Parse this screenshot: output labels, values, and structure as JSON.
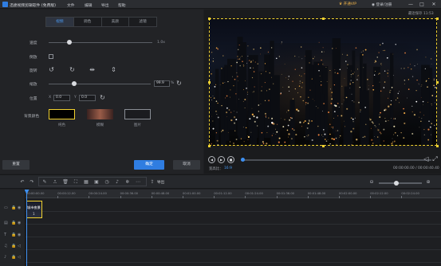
{
  "window": {
    "title": "迅捷视频剪辑软件 (免费版)",
    "menu": [
      "文件",
      "编辑",
      "导出",
      "帮助"
    ],
    "vip": "开通VIP",
    "login": "登录/注册",
    "controls": [
      "—",
      "□",
      "✕"
    ]
  },
  "edit_panel": {
    "tabs": [
      {
        "label": "视频",
        "active": true
      },
      {
        "label": "调色",
        "active": false
      },
      {
        "label": "美颜",
        "active": false
      },
      {
        "label": "滤镜",
        "active": false
      }
    ],
    "speed": {
      "label": "速度",
      "value": "1.0x",
      "level": 0.2
    },
    "reverse": {
      "label": "倒放",
      "checked": false
    },
    "rotate": {
      "label": "旋转",
      "icons": [
        "rotate-left-icon",
        "rotate-right-icon",
        "flip-horizontal-icon",
        "flip-vertical-icon"
      ]
    },
    "scale": {
      "label": "缩放",
      "value": "99.9",
      "unit": "%",
      "level": 0.25
    },
    "position": {
      "label": "位置",
      "x_label": "X",
      "x_value": "0.0",
      "y_label": "Y",
      "y_value": "0.0"
    },
    "background": {
      "label": "背景颜色",
      "options": [
        {
          "label": "纯色",
          "selected": true,
          "color": "#000000"
        },
        {
          "label": "模糊",
          "selected": false,
          "color": "#7a4a3a"
        },
        {
          "label": "图片",
          "selected": false,
          "color": "#1b1c1f"
        }
      ]
    },
    "buttons": {
      "reset": "重置",
      "ok": "确定",
      "cancel": "取消"
    }
  },
  "preview": {
    "autosave": "最近保存 11:53",
    "ratio_label": "宽高比：",
    "ratio_value": "16:9",
    "timecode": "00:00:00.00 / 00:00:40.40",
    "progress": 0.01
  },
  "timeline": {
    "export": "导出",
    "ruler": [
      "00:00:00.00",
      "00:00:12.00",
      "00:00:24.00",
      "00:00:36.00",
      "00:00:48.00",
      "00:01:00.00",
      "00:01:12.00",
      "00:01:24.00",
      "00:01:36.00",
      "00:01:48.00",
      "00:02:00.00",
      "00:02:12.00",
      "00:02:24.00"
    ],
    "clip": {
      "name": "城市夜景",
      "count": "1"
    },
    "zoom_level": 0.4
  },
  "colors": {
    "accent": "#2f7de1",
    "selection": "#f2d230"
  }
}
